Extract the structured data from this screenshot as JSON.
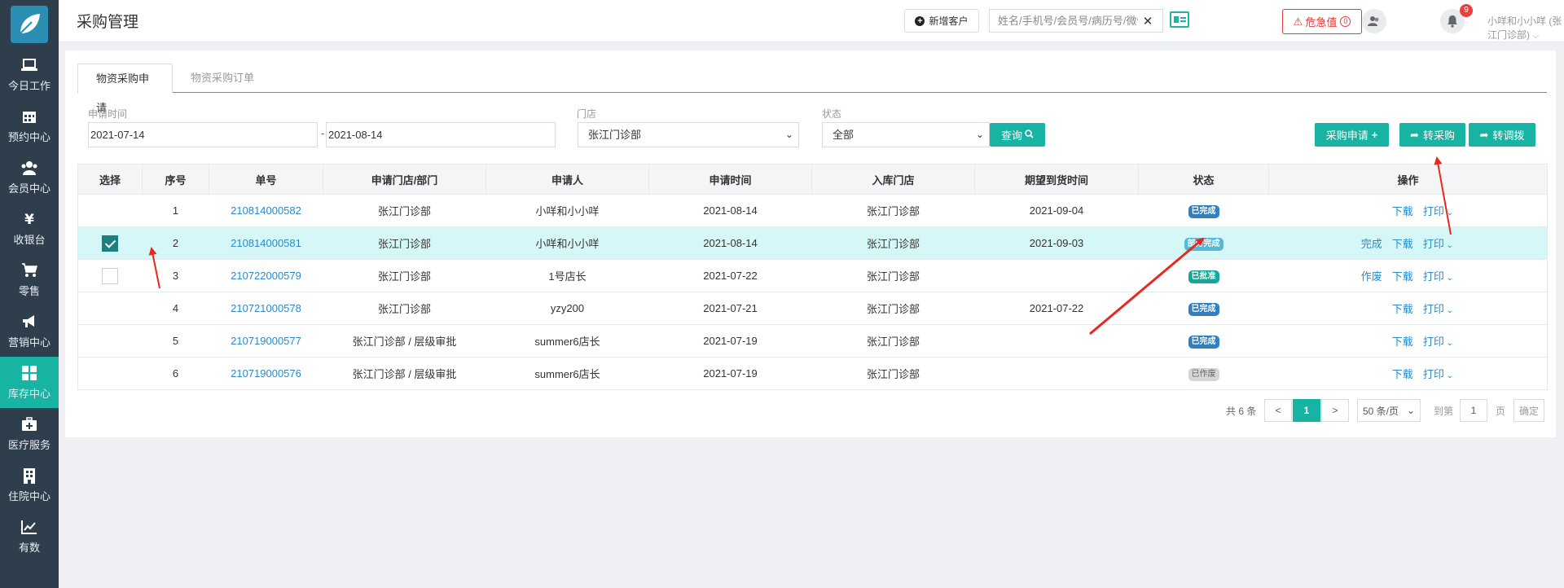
{
  "sidebar": {
    "items": [
      {
        "label": "今日工作",
        "icon": "laptop-icon",
        "active": false
      },
      {
        "label": "预约中心",
        "icon": "calendar-icon",
        "active": false
      },
      {
        "label": "会员中心",
        "icon": "users-icon",
        "active": false
      },
      {
        "label": "收银台",
        "icon": "yen-icon",
        "active": false
      },
      {
        "label": "零售",
        "icon": "cart-icon",
        "active": false
      },
      {
        "label": "营销中心",
        "icon": "megaphone-icon",
        "active": false
      },
      {
        "label": "库存中心",
        "icon": "grid-icon",
        "active": true
      },
      {
        "label": "医疗服务",
        "icon": "medkit-icon",
        "active": false
      },
      {
        "label": "住院中心",
        "icon": "building-icon",
        "active": false
      },
      {
        "label": "有数",
        "icon": "line-chart-icon",
        "active": false
      }
    ]
  },
  "header": {
    "title": "采购管理",
    "new_customer": "新增客户",
    "search_placeholder": "姓名/手机号/会员号/病历号/微信号",
    "danger_label": "危急值",
    "danger_count": "0",
    "notification_count": "9",
    "user": "小咩和小小咩 (张江门诊部)"
  },
  "tabs": [
    {
      "label": "物资采购申请",
      "active": true
    },
    {
      "label": "物资采购订单",
      "active": false
    }
  ],
  "filters": {
    "date_label": "申请时间",
    "date_from": "2021-07-14",
    "date_to": "2021-08-14",
    "store_label": "门店",
    "store_value": "张江门诊部",
    "status_label": "状态",
    "status_value": "全部",
    "query_button": "查询"
  },
  "actions": {
    "purchase_request": "采购申请",
    "to_purchase": "转采购",
    "to_transfer": "转调拨"
  },
  "table": {
    "headers": [
      "选择",
      "序号",
      "单号",
      "申请门店/部门",
      "申请人",
      "申请时间",
      "入库门店",
      "期望到货时间",
      "状态",
      "操作"
    ],
    "rows": [
      {
        "checkbox": false,
        "checked": false,
        "index": "1",
        "order_no": "210814000582",
        "dept": "张江门诊部",
        "applicant": "小咩和小小咩",
        "apply_time": "2021-08-14",
        "store": "张江门诊部",
        "expected": "2021-09-04",
        "status": "已完成",
        "status_color": "#2f7fc1",
        "ops": [
          "下载",
          "打印"
        ]
      },
      {
        "checkbox": true,
        "checked": true,
        "index": "2",
        "order_no": "210814000581",
        "dept": "张江门诊部",
        "applicant": "小咩和小小咩",
        "apply_time": "2021-08-14",
        "store": "张江门诊部",
        "expected": "2021-09-03",
        "status": "部分完成",
        "status_color": "#52b9d6",
        "ops": [
          "完成",
          "下载",
          "打印"
        ]
      },
      {
        "checkbox": true,
        "checked": false,
        "index": "3",
        "order_no": "210722000579",
        "dept": "张江门诊部",
        "applicant": "1号店长",
        "apply_time": "2021-07-22",
        "store": "张江门诊部",
        "expected": "",
        "status": "已批准",
        "status_color": "#17a69a",
        "ops": [
          "作废",
          "下载",
          "打印"
        ]
      },
      {
        "checkbox": false,
        "checked": false,
        "index": "4",
        "order_no": "210721000578",
        "dept": "张江门诊部",
        "applicant": "yzy200",
        "apply_time": "2021-07-21",
        "store": "张江门诊部",
        "expected": "2021-07-22",
        "status": "已完成",
        "status_color": "#2f7fc1",
        "ops": [
          "下载",
          "打印"
        ]
      },
      {
        "checkbox": false,
        "checked": false,
        "index": "5",
        "order_no": "210719000577",
        "dept": "张江门诊部 / 层级审批",
        "applicant": "summer6店长",
        "apply_time": "2021-07-19",
        "store": "张江门诊部",
        "expected": "",
        "status": "已完成",
        "status_color": "#2f7fc1",
        "ops": [
          "下载",
          "打印"
        ]
      },
      {
        "checkbox": false,
        "checked": false,
        "index": "6",
        "order_no": "210719000576",
        "dept": "张江门诊部 / 层级审批",
        "applicant": "summer6店长",
        "apply_time": "2021-07-19",
        "store": "张江门诊部",
        "expected": "",
        "status": "已作废",
        "status_color": "#d4d6d8",
        "ops": [
          "下载",
          "打印"
        ]
      }
    ]
  },
  "pagination": {
    "total": "共 6 条",
    "prev": "<",
    "page": "1",
    "next": ">",
    "page_size": "50 条/页",
    "goto_label": "到第",
    "goto_value": "1",
    "page_unit": "页",
    "confirm": "确定"
  },
  "colors": {
    "accent": "#17b3a3",
    "sidebar": "#2f3e4c",
    "link": "#2a8bc9",
    "danger": "#e23c3c",
    "annotation_arrow": "#e8281e"
  }
}
